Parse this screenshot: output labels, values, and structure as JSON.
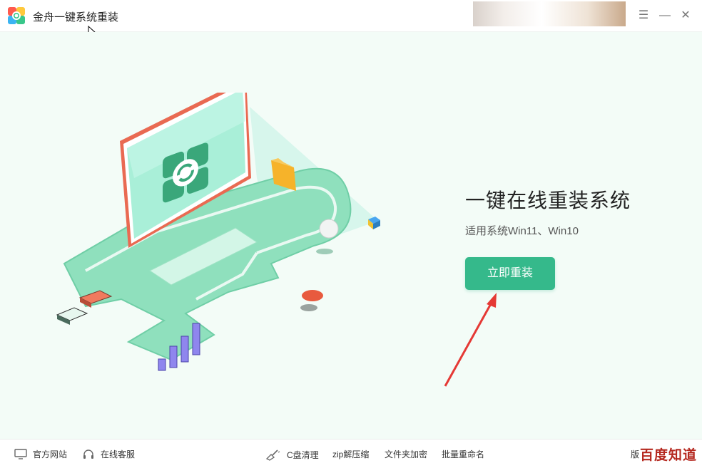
{
  "window": {
    "title": "金舟一键系统重装",
    "menu_glyph": "☰",
    "minimize_glyph": "—",
    "close_glyph": "✕"
  },
  "main": {
    "headline": "一键在线重装系统",
    "subline": "适用系统Win11、Win10",
    "cta_label": "立即重装"
  },
  "footer": {
    "items": [
      {
        "label": "官方网站",
        "icon": "monitor-icon"
      },
      {
        "label": "在线客服",
        "icon": "headset-icon"
      },
      {
        "label": "C盘清理",
        "icon": "broom-icon"
      },
      {
        "label": "zip解压缩",
        "icon": ""
      },
      {
        "label": "文件夹加密",
        "icon": ""
      },
      {
        "label": "批量重命名",
        "icon": ""
      }
    ],
    "version_prefix": "版",
    "watermark": "百度知道"
  },
  "colors": {
    "accent": "#35b98b",
    "background": "#f3fcf7",
    "annotation_arrow": "#e53935"
  }
}
